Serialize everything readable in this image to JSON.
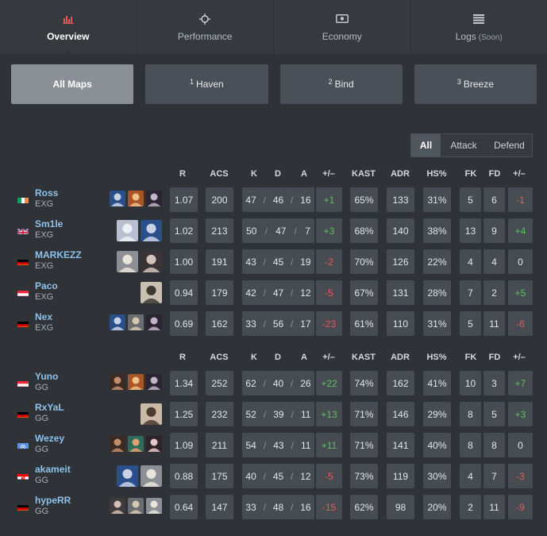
{
  "tabs": [
    {
      "label": "Overview",
      "icon": "bar-chart-icon",
      "active": true
    },
    {
      "label": "Performance",
      "icon": "crosshair-icon",
      "active": false
    },
    {
      "label": "Economy",
      "icon": "money-icon",
      "active": false
    },
    {
      "label": "Logs",
      "soon": "(Soon)",
      "icon": "list-icon",
      "active": false
    }
  ],
  "maps": [
    {
      "num": "",
      "label": "All Maps",
      "active": true
    },
    {
      "num": "1",
      "label": "Haven",
      "active": false
    },
    {
      "num": "2",
      "label": "Bind",
      "active": false
    },
    {
      "num": "3",
      "label": "Breeze",
      "active": false
    }
  ],
  "side_filter": [
    "All",
    "Attack",
    "Defend"
  ],
  "columns": [
    "R",
    "ACS",
    "K",
    "D",
    "A",
    "+/–",
    "KAST",
    "ADR",
    "HS%",
    "FK",
    "FD",
    "+/–"
  ],
  "teams": [
    {
      "players": [
        {
          "name": "Ross",
          "team": "EXG",
          "flag": "ie",
          "agents": [
            "agent-a",
            "agent-b",
            "agent-c"
          ],
          "r": "1.07",
          "acs": "200",
          "k": "47",
          "d": "46",
          "a": "16",
          "pm": "+1",
          "kast": "65%",
          "adr": "133",
          "hs": "31%",
          "fk": "5",
          "fd": "6",
          "fpm": "-1"
        },
        {
          "name": "Sm1le",
          "team": "EXG",
          "flag": "gb",
          "agents": [
            "agent-d",
            "agent-a"
          ],
          "r": "1.02",
          "acs": "213",
          "k": "50",
          "d": "47",
          "a": "7",
          "pm": "+3",
          "kast": "68%",
          "adr": "140",
          "hs": "38%",
          "fk": "13",
          "fd": "9",
          "fpm": "+4"
        },
        {
          "name": "MARKEZZ",
          "team": "EXG",
          "flag": "de",
          "agents": [
            "agent-e",
            "agent-f"
          ],
          "r": "1.00",
          "acs": "191",
          "k": "43",
          "d": "45",
          "a": "19",
          "pm": "-2",
          "kast": "70%",
          "adr": "126",
          "hs": "22%",
          "fk": "4",
          "fd": "4",
          "fpm": "0"
        },
        {
          "name": "Paco",
          "team": "EXG",
          "flag": "at",
          "agents": [
            "agent-g"
          ],
          "r": "0.94",
          "acs": "179",
          "k": "42",
          "d": "47",
          "a": "12",
          "pm": "-5",
          "kast": "67%",
          "adr": "131",
          "hs": "28%",
          "fk": "7",
          "fd": "2",
          "fpm": "+5"
        },
        {
          "name": "Nex",
          "team": "EXG",
          "flag": "de",
          "agents": [
            "agent-a",
            "agent-h",
            "agent-c"
          ],
          "r": "0.69",
          "acs": "162",
          "k": "33",
          "d": "56",
          "a": "17",
          "pm": "-23",
          "kast": "61%",
          "adr": "110",
          "hs": "31%",
          "fk": "5",
          "fd": "11",
          "fpm": "-6"
        }
      ]
    },
    {
      "players": [
        {
          "name": "Yuno",
          "team": "GG",
          "flag": "at",
          "agents": [
            "agent-i",
            "agent-b",
            "agent-c"
          ],
          "r": "1.34",
          "acs": "252",
          "k": "62",
          "d": "40",
          "a": "26",
          "pm": "+22",
          "kast": "74%",
          "adr": "162",
          "hs": "41%",
          "fk": "10",
          "fd": "3",
          "fpm": "+7"
        },
        {
          "name": "RxYaL",
          "team": "GG",
          "flag": "de",
          "agents": [
            "agent-j"
          ],
          "r": "1.25",
          "acs": "232",
          "k": "52",
          "d": "39",
          "a": "11",
          "pm": "+13",
          "kast": "71%",
          "adr": "146",
          "hs": "29%",
          "fk": "8",
          "fd": "5",
          "fpm": "+3"
        },
        {
          "name": "Wezey",
          "team": "GG",
          "flag": "un",
          "agents": [
            "agent-i",
            "agent-k",
            "agent-l"
          ],
          "r": "1.09",
          "acs": "211",
          "k": "54",
          "d": "43",
          "a": "11",
          "pm": "+11",
          "kast": "71%",
          "adr": "141",
          "hs": "40%",
          "fk": "8",
          "fd": "8",
          "fpm": "0"
        },
        {
          "name": "akameit",
          "team": "GG",
          "flag": "hr",
          "agents": [
            "agent-a",
            "agent-e"
          ],
          "r": "0.88",
          "acs": "175",
          "k": "40",
          "d": "45",
          "a": "12",
          "pm": "-5",
          "kast": "73%",
          "adr": "119",
          "hs": "30%",
          "fk": "4",
          "fd": "7",
          "fpm": "-3"
        },
        {
          "name": "hypeRR",
          "team": "GG",
          "flag": "de",
          "agents": [
            "agent-m",
            "agent-h",
            "agent-e"
          ],
          "r": "0.64",
          "acs": "147",
          "k": "33",
          "d": "48",
          "a": "16",
          "pm": "-15",
          "kast": "62%",
          "adr": "98",
          "hs": "20%",
          "fk": "2",
          "fd": "11",
          "fpm": "-9"
        }
      ]
    }
  ],
  "colors": {
    "positive": "#5fbf5f",
    "negative": "#e65a5a",
    "player_name": "#8fc2ea",
    "cell_bg": "#474c53"
  }
}
